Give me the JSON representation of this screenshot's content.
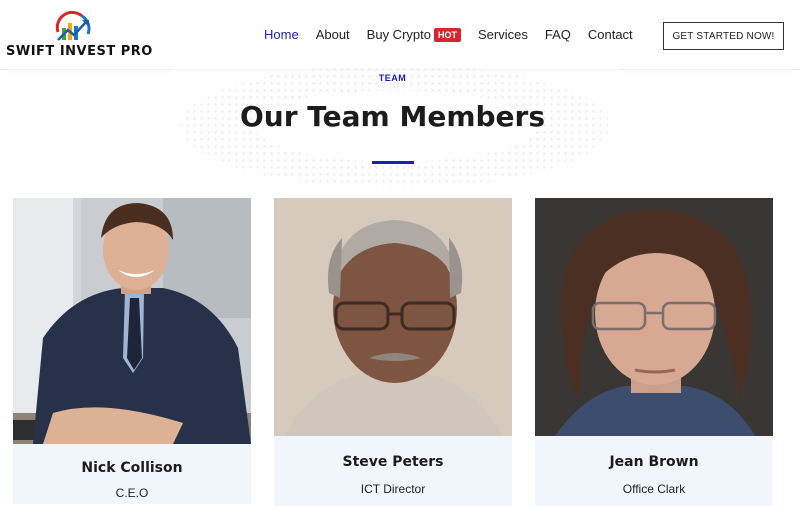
{
  "brand": {
    "name": "SWIFT INVEST PRO",
    "logo_icon": "chart-arrow-logo-icon"
  },
  "nav": {
    "items": [
      {
        "label": "Home",
        "active": true
      },
      {
        "label": "About"
      },
      {
        "label": "Buy Crypto",
        "badge": "HOT"
      },
      {
        "label": "Services"
      },
      {
        "label": "FAQ"
      },
      {
        "label": "Contact"
      }
    ],
    "cta": "GET STARTED NOW!"
  },
  "section": {
    "tag": "TEAM",
    "title": "Our Team Members"
  },
  "team": [
    {
      "name": "Nick Collison",
      "role": "C.E.O"
    },
    {
      "name": "Steve Peters",
      "role": "ICT Director"
    },
    {
      "name": "Jean Brown",
      "role": "Office Clark"
    }
  ],
  "colors": {
    "accent": "#1c1fb5",
    "hot_badge": "#d9262e",
    "card_bg": "#f1f6fc"
  }
}
